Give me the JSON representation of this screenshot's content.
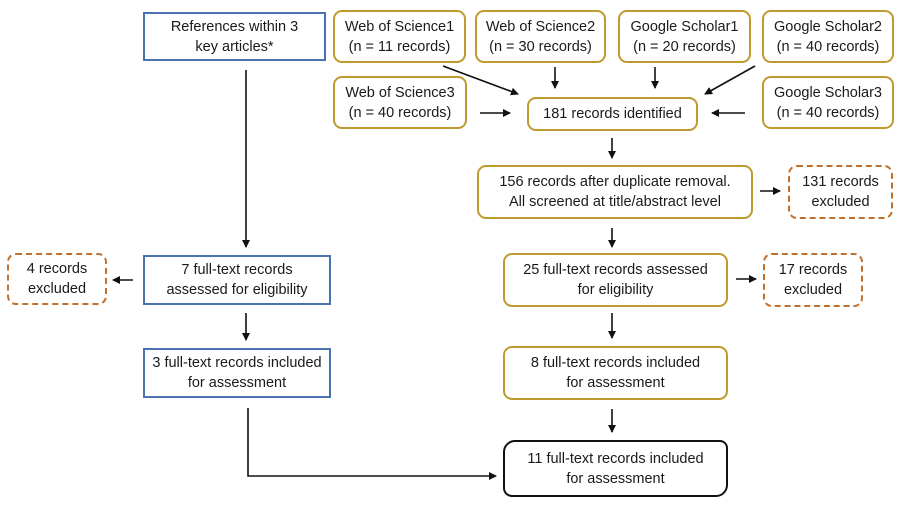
{
  "diagram": {
    "type": "PRISMA flow diagram",
    "colors": {
      "reference_branch": "#4a72b0",
      "database_branch": "#bf9a2e",
      "excluded": "#c0702e",
      "final": "#111111",
      "arrow": "#111111"
    },
    "nodes": {
      "references": {
        "line1": "References within 3",
        "line2": "key articles*"
      },
      "wos1": {
        "line1": "Web of Science1",
        "line2": "(n = 11 records)"
      },
      "wos2": {
        "line1": "Web of Science2",
        "line2": "(n = 30 records)"
      },
      "gs1": {
        "line1": "Google Scholar1",
        "line2": "(n = 20 records)"
      },
      "gs2": {
        "line1": "Google Scholar2",
        "line2": "(n = 40 records)"
      },
      "wos3": {
        "line1": "Web of Science3",
        "line2": "(n = 40 records)"
      },
      "gs3": {
        "line1": "Google Scholar3",
        "line2": "(n = 40 records)"
      },
      "identified": {
        "line1": "181 records identified"
      },
      "dedup": {
        "line1": "156 records after duplicate removal.",
        "line2": "All screened at title/abstract level"
      },
      "excluded_131": {
        "line1": "131 records",
        "line2": "excluded"
      },
      "ref_assessed": {
        "line1": "7 full-text records",
        "line2": "assessed for eligibility"
      },
      "excluded_4": {
        "line1": "4 records",
        "line2": "excluded"
      },
      "db_assessed": {
        "line1": "25 full-text records assessed",
        "line2": "for eligibility"
      },
      "excluded_17": {
        "line1": "17 records",
        "line2": "excluded"
      },
      "ref_included": {
        "line1": "3 full-text records included",
        "line2": "for assessment"
      },
      "db_included": {
        "line1": "8 full-text records included",
        "line2": "for assessment"
      },
      "total_included": {
        "line1": "11 full-text records included",
        "line2": "for assessment"
      }
    },
    "edges": [
      [
        "wos1",
        "identified"
      ],
      [
        "wos2",
        "identified"
      ],
      [
        "gs1",
        "identified"
      ],
      [
        "gs2",
        "identified"
      ],
      [
        "wos3",
        "identified"
      ],
      [
        "gs3",
        "identified"
      ],
      [
        "identified",
        "dedup"
      ],
      [
        "dedup",
        "excluded_131"
      ],
      [
        "dedup",
        "db_assessed"
      ],
      [
        "db_assessed",
        "excluded_17"
      ],
      [
        "db_assessed",
        "db_included"
      ],
      [
        "db_included",
        "total_included"
      ],
      [
        "references",
        "ref_assessed"
      ],
      [
        "ref_assessed",
        "excluded_4"
      ],
      [
        "ref_assessed",
        "ref_included"
      ],
      [
        "ref_included",
        "total_included"
      ]
    ]
  }
}
